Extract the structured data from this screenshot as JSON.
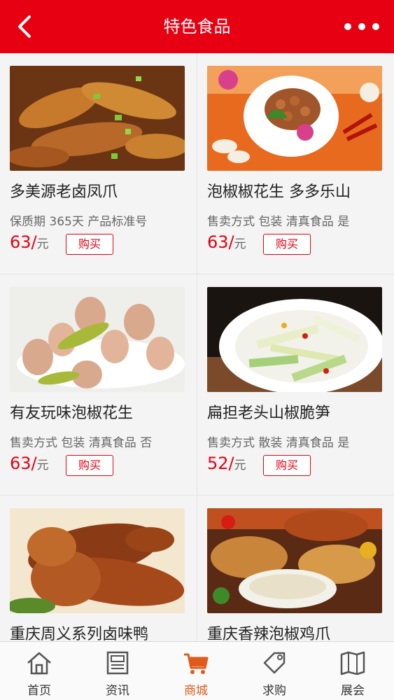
{
  "header": {
    "title": "特色食品"
  },
  "products": [
    {
      "name": "多美源老卤凤爪",
      "attrs": "保质期 365天 产品标准号",
      "price": "63/",
      "unit": "元",
      "buy_label": "购买"
    },
    {
      "name": "泡椒椒花生 多多乐山",
      "attrs": "售卖方式 包装 清真食品 是",
      "price": "63/",
      "unit": "元",
      "buy_label": "购买"
    },
    {
      "name": "有友玩味泡椒花生",
      "attrs": "售卖方式 包装 清真食品 否",
      "price": "63/",
      "unit": "元",
      "buy_label": "购买"
    },
    {
      "name": "扁担老头山椒脆笋",
      "attrs": "售卖方式 散装 清真食品 是",
      "price": "52/",
      "unit": "元",
      "buy_label": "购买"
    },
    {
      "name": "重庆周义系列卤味鸭",
      "attrs": "",
      "price": "",
      "unit": "",
      "buy_label": ""
    },
    {
      "name": "重庆香辣泡椒鸡爪",
      "attrs": "",
      "price": "",
      "unit": "",
      "buy_label": ""
    }
  ],
  "tabbar": {
    "items": [
      {
        "label": "首页",
        "icon": "home-icon"
      },
      {
        "label": "资讯",
        "icon": "news-icon"
      },
      {
        "label": "商城",
        "icon": "cart-icon"
      },
      {
        "label": "求购",
        "icon": "tag-icon"
      },
      {
        "label": "展会",
        "icon": "map-icon"
      }
    ],
    "active_color": "#e05a1a"
  },
  "colors": {
    "brand": "#e60012"
  }
}
